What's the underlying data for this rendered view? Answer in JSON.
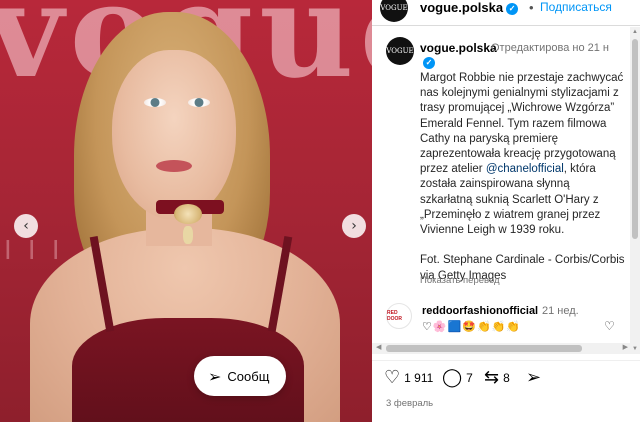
{
  "photo": {
    "backdrop_text": "vogue",
    "backdrop_small": "I I I",
    "prev_label": "‹",
    "next_label": "›"
  },
  "header": {
    "avatar_text": "VOGUE",
    "username": "vogue.polska",
    "verified": "✓",
    "bullet": "•",
    "follow_label": "Подписаться"
  },
  "caption": {
    "avatar_text": "VOGUE",
    "username": "vogue.polska",
    "edited_label": "Отредактирова но",
    "time": "21 н",
    "text_part1": "Margot Robbie nie przestaje zachwycać nas kolejnymi genialnymi stylizacjami z trasy promującej „Wichrowe Wzgórza” Emerald Fennel. Tym razem filmowa Cathy na paryską premierę zaprezentowała kreację przygotowaną przez atelier ",
    "mention": "@chanelofficial",
    "text_part2": ", która została zainspirowana słynną szkarłatną suknią Scarlett O'Hary z „Przeminęło z wiatrem granej przez Vivienne Leigh w 1939 roku.\n\nFot. Stephane Cardinale - Corbis/Corbis via Getty Images",
    "translate_label": "Показать перевод"
  },
  "comment": {
    "avatar_text": "RED DOOR",
    "username": "reddoorfashionofficial",
    "time": "21 нед.",
    "text": "♡🌸🟦🤩👏👏👏",
    "like_icon": "♡"
  },
  "scrollbars": {
    "up": "▲",
    "down": "▼",
    "left": "◀",
    "right": "▶"
  },
  "actions": {
    "like_icon": "♡",
    "likes": "1 911",
    "comment_icon": "◯",
    "comments": "7",
    "repost_icon": "⇆",
    "reposts": "8",
    "send_icon": "➢",
    "share_icon": "➢",
    "share_label": "Сообщ",
    "date": "3 февраль"
  },
  "icons": [
    "verified-icon",
    "heart-icon",
    "comment-icon",
    "repost-icon",
    "send-icon",
    "chevron-left-icon",
    "chevron-right-icon"
  ]
}
